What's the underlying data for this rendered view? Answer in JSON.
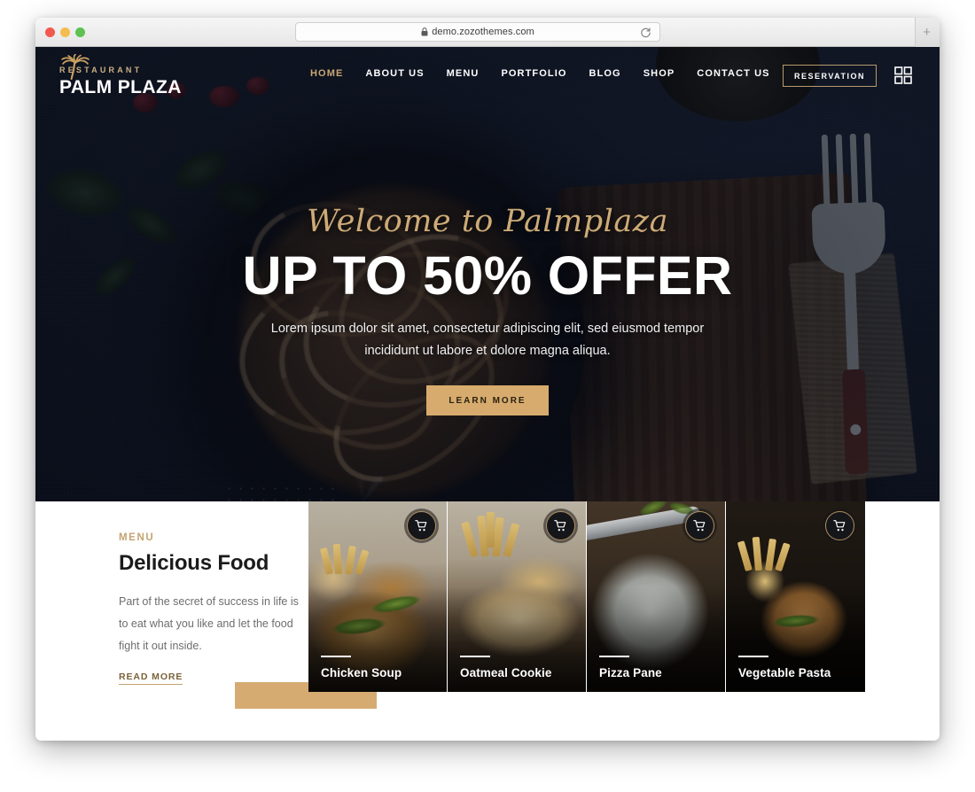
{
  "browser": {
    "url": "demo.zozothemes.com",
    "lock_icon": "lock-icon",
    "reload_icon": "reload-icon",
    "new_tab_label": "+",
    "traffic_lights": [
      "close-red",
      "minimize-yellow",
      "maximize-green"
    ]
  },
  "header": {
    "logo": {
      "icon": "palm-tree-icon",
      "eyebrow": "RESTAURANT",
      "title": "PALM PLAZA"
    },
    "nav": [
      {
        "label": "HOME",
        "active": true
      },
      {
        "label": "ABOUT US",
        "active": false
      },
      {
        "label": "MENU",
        "active": false
      },
      {
        "label": "PORTFOLIO",
        "active": false
      },
      {
        "label": "BLOG",
        "active": false
      },
      {
        "label": "SHOP",
        "active": false
      },
      {
        "label": "CONTACT US",
        "active": false
      }
    ],
    "reservation_label": "RESERVATION",
    "grid_toggle_icon": "grid-squares-icon"
  },
  "hero": {
    "script_title": "Welcome to Palmplaza",
    "headline": "UP TO 50% OFFER",
    "subtext": "Lorem ipsum dolor sit amet, consectetur adipiscing elit, sed eiusmod tempor incididunt ut labore et dolore magna aliqua.",
    "cta_label": "LEARN MORE"
  },
  "menu_section": {
    "eyebrow": "MENU",
    "heading": "Delicious Food",
    "description": "Part of the secret of success in life is to eat what you like and let the food fight it out inside.",
    "read_more_label": "READ MORE",
    "cards": [
      {
        "title": "Chicken Soup",
        "cart_icon": "shopping-cart-icon"
      },
      {
        "title": "Oatmeal Cookie",
        "cart_icon": "shopping-cart-icon"
      },
      {
        "title": "Pizza Pane",
        "cart_icon": "shopping-cart-icon"
      },
      {
        "title": "Vegetable Pasta",
        "cart_icon": "shopping-cart-icon"
      }
    ]
  },
  "colors": {
    "gold": "#c9a874",
    "gold_button": "#d7ab6d",
    "hero_dark": "#0f1625",
    "text_dark": "#1b1b1b",
    "text_muted": "#6d6d6d"
  }
}
